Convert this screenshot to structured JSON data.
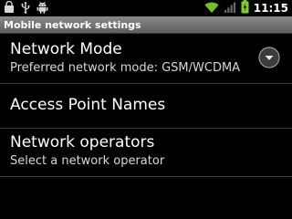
{
  "status_bar": {
    "clock": "11:15",
    "icons": [
      "shopping-bag-icon",
      "usb-icon",
      "android-debug-icon",
      "wifi-icon",
      "signal-icon",
      "battery-charging-icon"
    ]
  },
  "title_bar": {
    "title": "Mobile network settings"
  },
  "preferences": [
    {
      "title": "Network Mode",
      "summary": "Preferred network mode: GSM/WCDMA",
      "widget": "chevron-down-icon"
    },
    {
      "title": "Access Point Names",
      "summary": ""
    },
    {
      "title": "Network operators",
      "summary": "Select a network operator"
    }
  ],
  "colors": {
    "background": "#000000",
    "title_bar": "#7a7a7a",
    "divider": "#3a3a3a",
    "battery_accent": "#7dd21f"
  }
}
